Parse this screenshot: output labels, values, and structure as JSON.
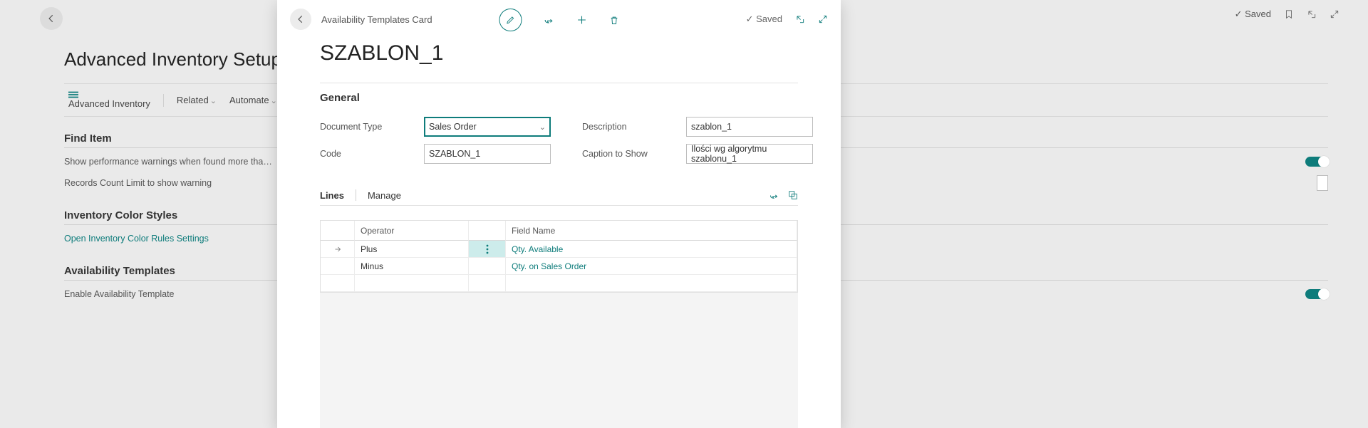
{
  "bg": {
    "title": "Advanced Inventory Setup",
    "actions": {
      "advanced_inventory": "Advanced Inventory",
      "related": "Related",
      "automate": "Automate"
    },
    "top": {
      "saved": "Saved"
    },
    "find_item": {
      "title": "Find Item",
      "row1": "Show performance warnings when found more tha…",
      "row2": "Records Count Limit to show warning"
    },
    "color": {
      "title": "Inventory Color Styles",
      "link": "Open Inventory Color Rules Settings"
    },
    "avail": {
      "title": "Availability Templates",
      "row1": "Enable Availability Template"
    }
  },
  "card": {
    "crumb": "Availability Templates Card",
    "saved": "Saved",
    "title": "SZABLON_1",
    "general": "General",
    "fields": {
      "document_type_label": "Document Type",
      "document_type_value": "Sales Order",
      "code_label": "Code",
      "code_value": "SZABLON_1",
      "description_label": "Description",
      "description_value": "szablon_1",
      "caption_label": "Caption to Show",
      "caption_value": "Ilości wg algorytmu szablonu_1"
    },
    "lines": {
      "title": "Lines",
      "manage": "Manage",
      "col_operator": "Operator",
      "col_field": "Field Name",
      "rows": [
        {
          "op": "Plus",
          "field": "Qty. Available"
        },
        {
          "op": "Minus",
          "field": "Qty. on Sales Order"
        }
      ]
    }
  }
}
